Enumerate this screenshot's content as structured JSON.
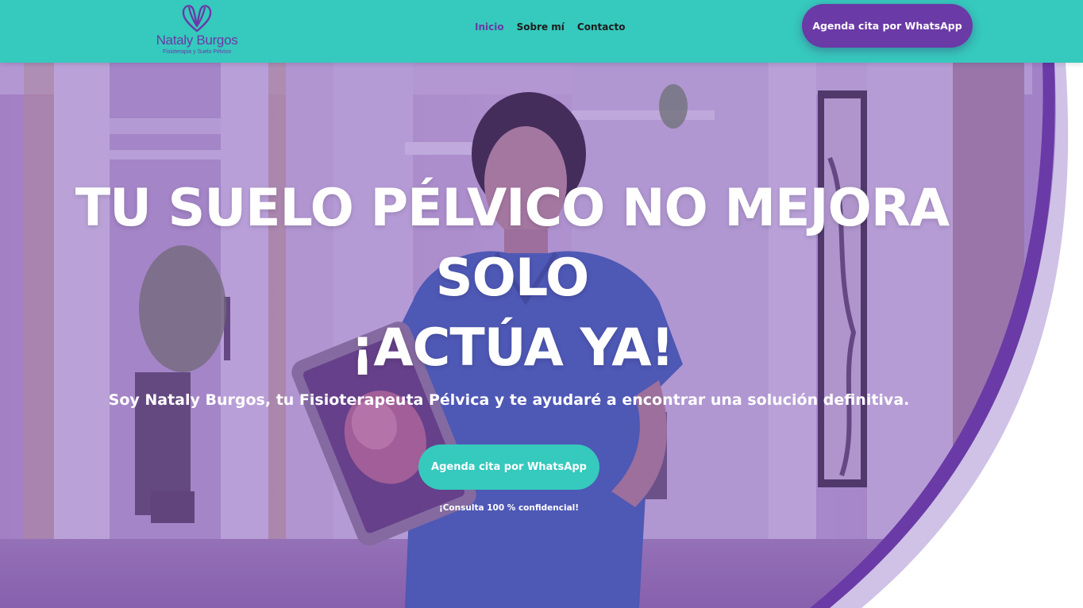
{
  "colors": {
    "header_bg": "#36c9bd",
    "brand_purple": "#6a3aa6",
    "hero_overlay": "#7a45b8",
    "cta_teal": "#36c9bd",
    "light_purple": "#cfc2e6"
  },
  "header": {
    "logo": {
      "name": "Nataly Burgos",
      "tagline": "Fisioterapia y Suelo Pélvico",
      "icon": "heart-w-logo-icon"
    },
    "nav": [
      {
        "label": "Inicio",
        "active": true
      },
      {
        "label": "Sobre mí",
        "active": false
      },
      {
        "label": "Contacto",
        "active": false
      }
    ],
    "cta_label": "Agenda cita por WhatsApp"
  },
  "hero": {
    "headline_line1": "TU SUELO PÉLVICO NO MEJORA",
    "headline_line2": "SOLO",
    "headline_line3": "¡ACTÚA YA!",
    "subtitle": "Soy Nataly Burgos, tu Fisioterapeuta Pélvica y te ayudaré a encontrar una solución definitiva.",
    "cta_label": "Agenda cita por WhatsApp",
    "note": "¡Consulta 100 % confidencial!"
  }
}
